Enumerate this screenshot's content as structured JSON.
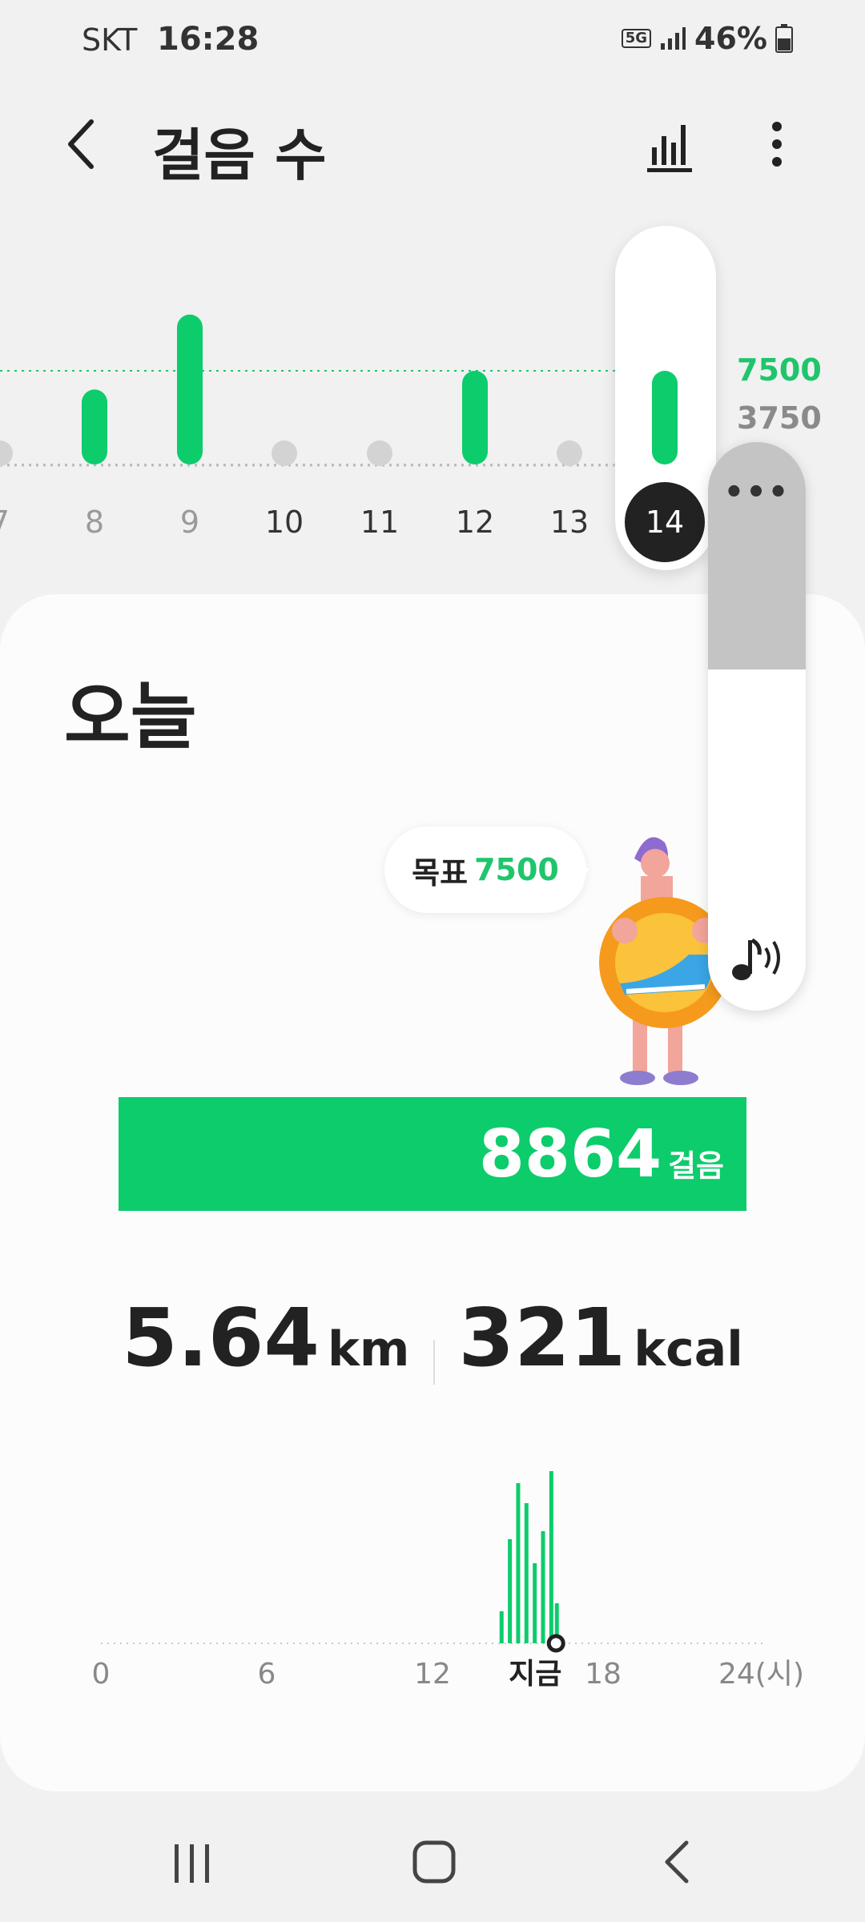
{
  "status_bar": {
    "carrier": "SKT",
    "time": "16:28",
    "network": "5G",
    "battery": "46%"
  },
  "header": {
    "title": "걸음 수",
    "back_icon": "chevron-left-icon",
    "graph_icon": "bar-chart-icon",
    "more_icon": "more-vertical-icon"
  },
  "colors": {
    "accent": "#0dcc6c",
    "goal_text": "#1fc56c",
    "selected_day_bg": "#222222"
  },
  "weekly_chart": {
    "days": [
      "7",
      "8",
      "9",
      "10",
      "11",
      "12",
      "13",
      "14"
    ],
    "steps": [
      0,
      6000,
      12000,
      0,
      0,
      7500,
      0,
      7500
    ],
    "selected_day": "14",
    "goal_label": "7500",
    "half_goal_label": "3750",
    "goal": 7500,
    "half_goal": 3750
  },
  "today": {
    "title": "오늘",
    "goal_prefix": "목표",
    "goal_value": "7500",
    "steps": "8864",
    "steps_unit": "걸음",
    "distance": "5.64",
    "distance_unit": "km",
    "calories": "321",
    "calories_unit": "kcal"
  },
  "chart_data": {
    "type": "bar",
    "xlabel": "",
    "ylabel": "",
    "x_ticks": [
      "0",
      "6",
      "12",
      "지금",
      "18",
      "24(시)"
    ],
    "xlim": [
      0,
      24
    ],
    "hours": [
      14.5,
      14.8,
      15.1,
      15.4,
      15.7,
      16.0,
      16.3,
      16.5
    ],
    "values": [
      40,
      130,
      200,
      175,
      100,
      140,
      215,
      50
    ],
    "now_hour": 16.47
  },
  "volume_panel": {
    "menu_icon": "more-horizontal-icon",
    "level": 0.6,
    "sound_icon": "music-note-sound-icon"
  },
  "nav_bar": {
    "recent": "recent-apps-icon",
    "home": "home-icon",
    "back": "back-icon"
  }
}
